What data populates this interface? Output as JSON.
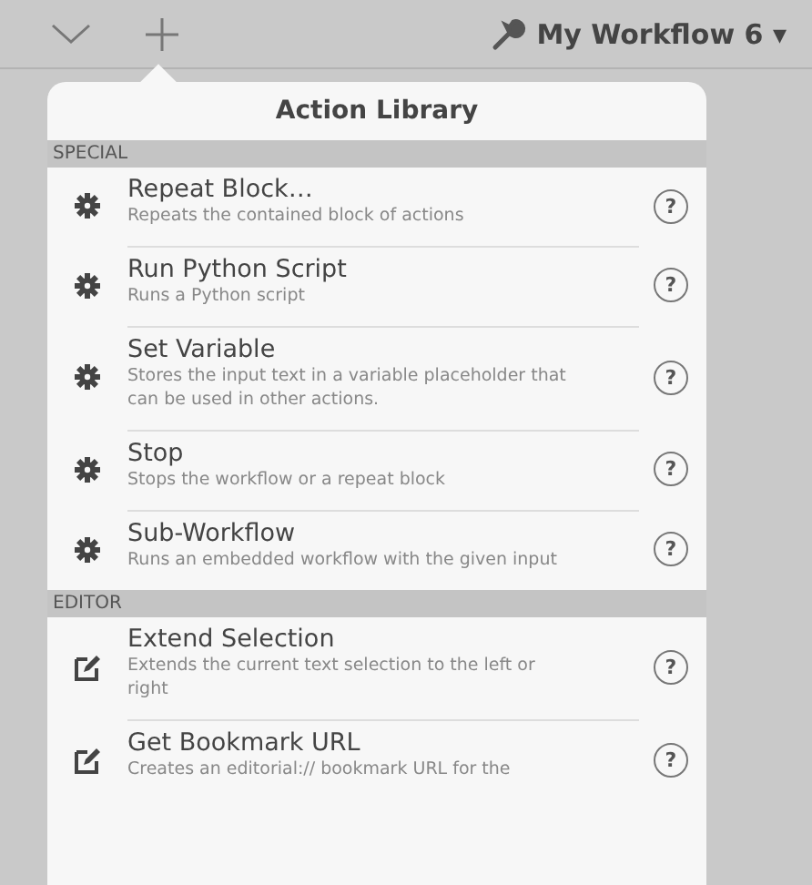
{
  "toolbar": {
    "title": "My Workflow 6 ▾"
  },
  "popover": {
    "title": "Action Library",
    "sections": [
      {
        "header": "SPECIAL",
        "items": [
          {
            "kind": "gear",
            "title": "Repeat Block…",
            "subtitle": "Repeats the contained block of actions",
            "help": "?"
          },
          {
            "kind": "gear",
            "title": "Run Python Script",
            "subtitle": "Runs a Python script",
            "help": "?"
          },
          {
            "kind": "gear",
            "title": "Set Variable",
            "subtitle": "Stores the input text in a variable placeholder that can be used in other actions.",
            "help": "?"
          },
          {
            "kind": "gear",
            "title": "Stop",
            "subtitle": "Stops the workflow or a repeat block",
            "help": "?"
          },
          {
            "kind": "gear",
            "title": "Sub-Workflow",
            "subtitle": "Runs an embedded workflow with the given input",
            "help": "?"
          }
        ]
      },
      {
        "header": "EDITOR",
        "items": [
          {
            "kind": "pencil",
            "title": "Extend Selection",
            "subtitle": "Extends the current text selection to the left or right",
            "help": "?"
          },
          {
            "kind": "pencil",
            "title": "Get Bookmark URL",
            "subtitle": "Creates an editorial:// bookmark URL for the",
            "help": "?"
          }
        ]
      }
    ]
  }
}
